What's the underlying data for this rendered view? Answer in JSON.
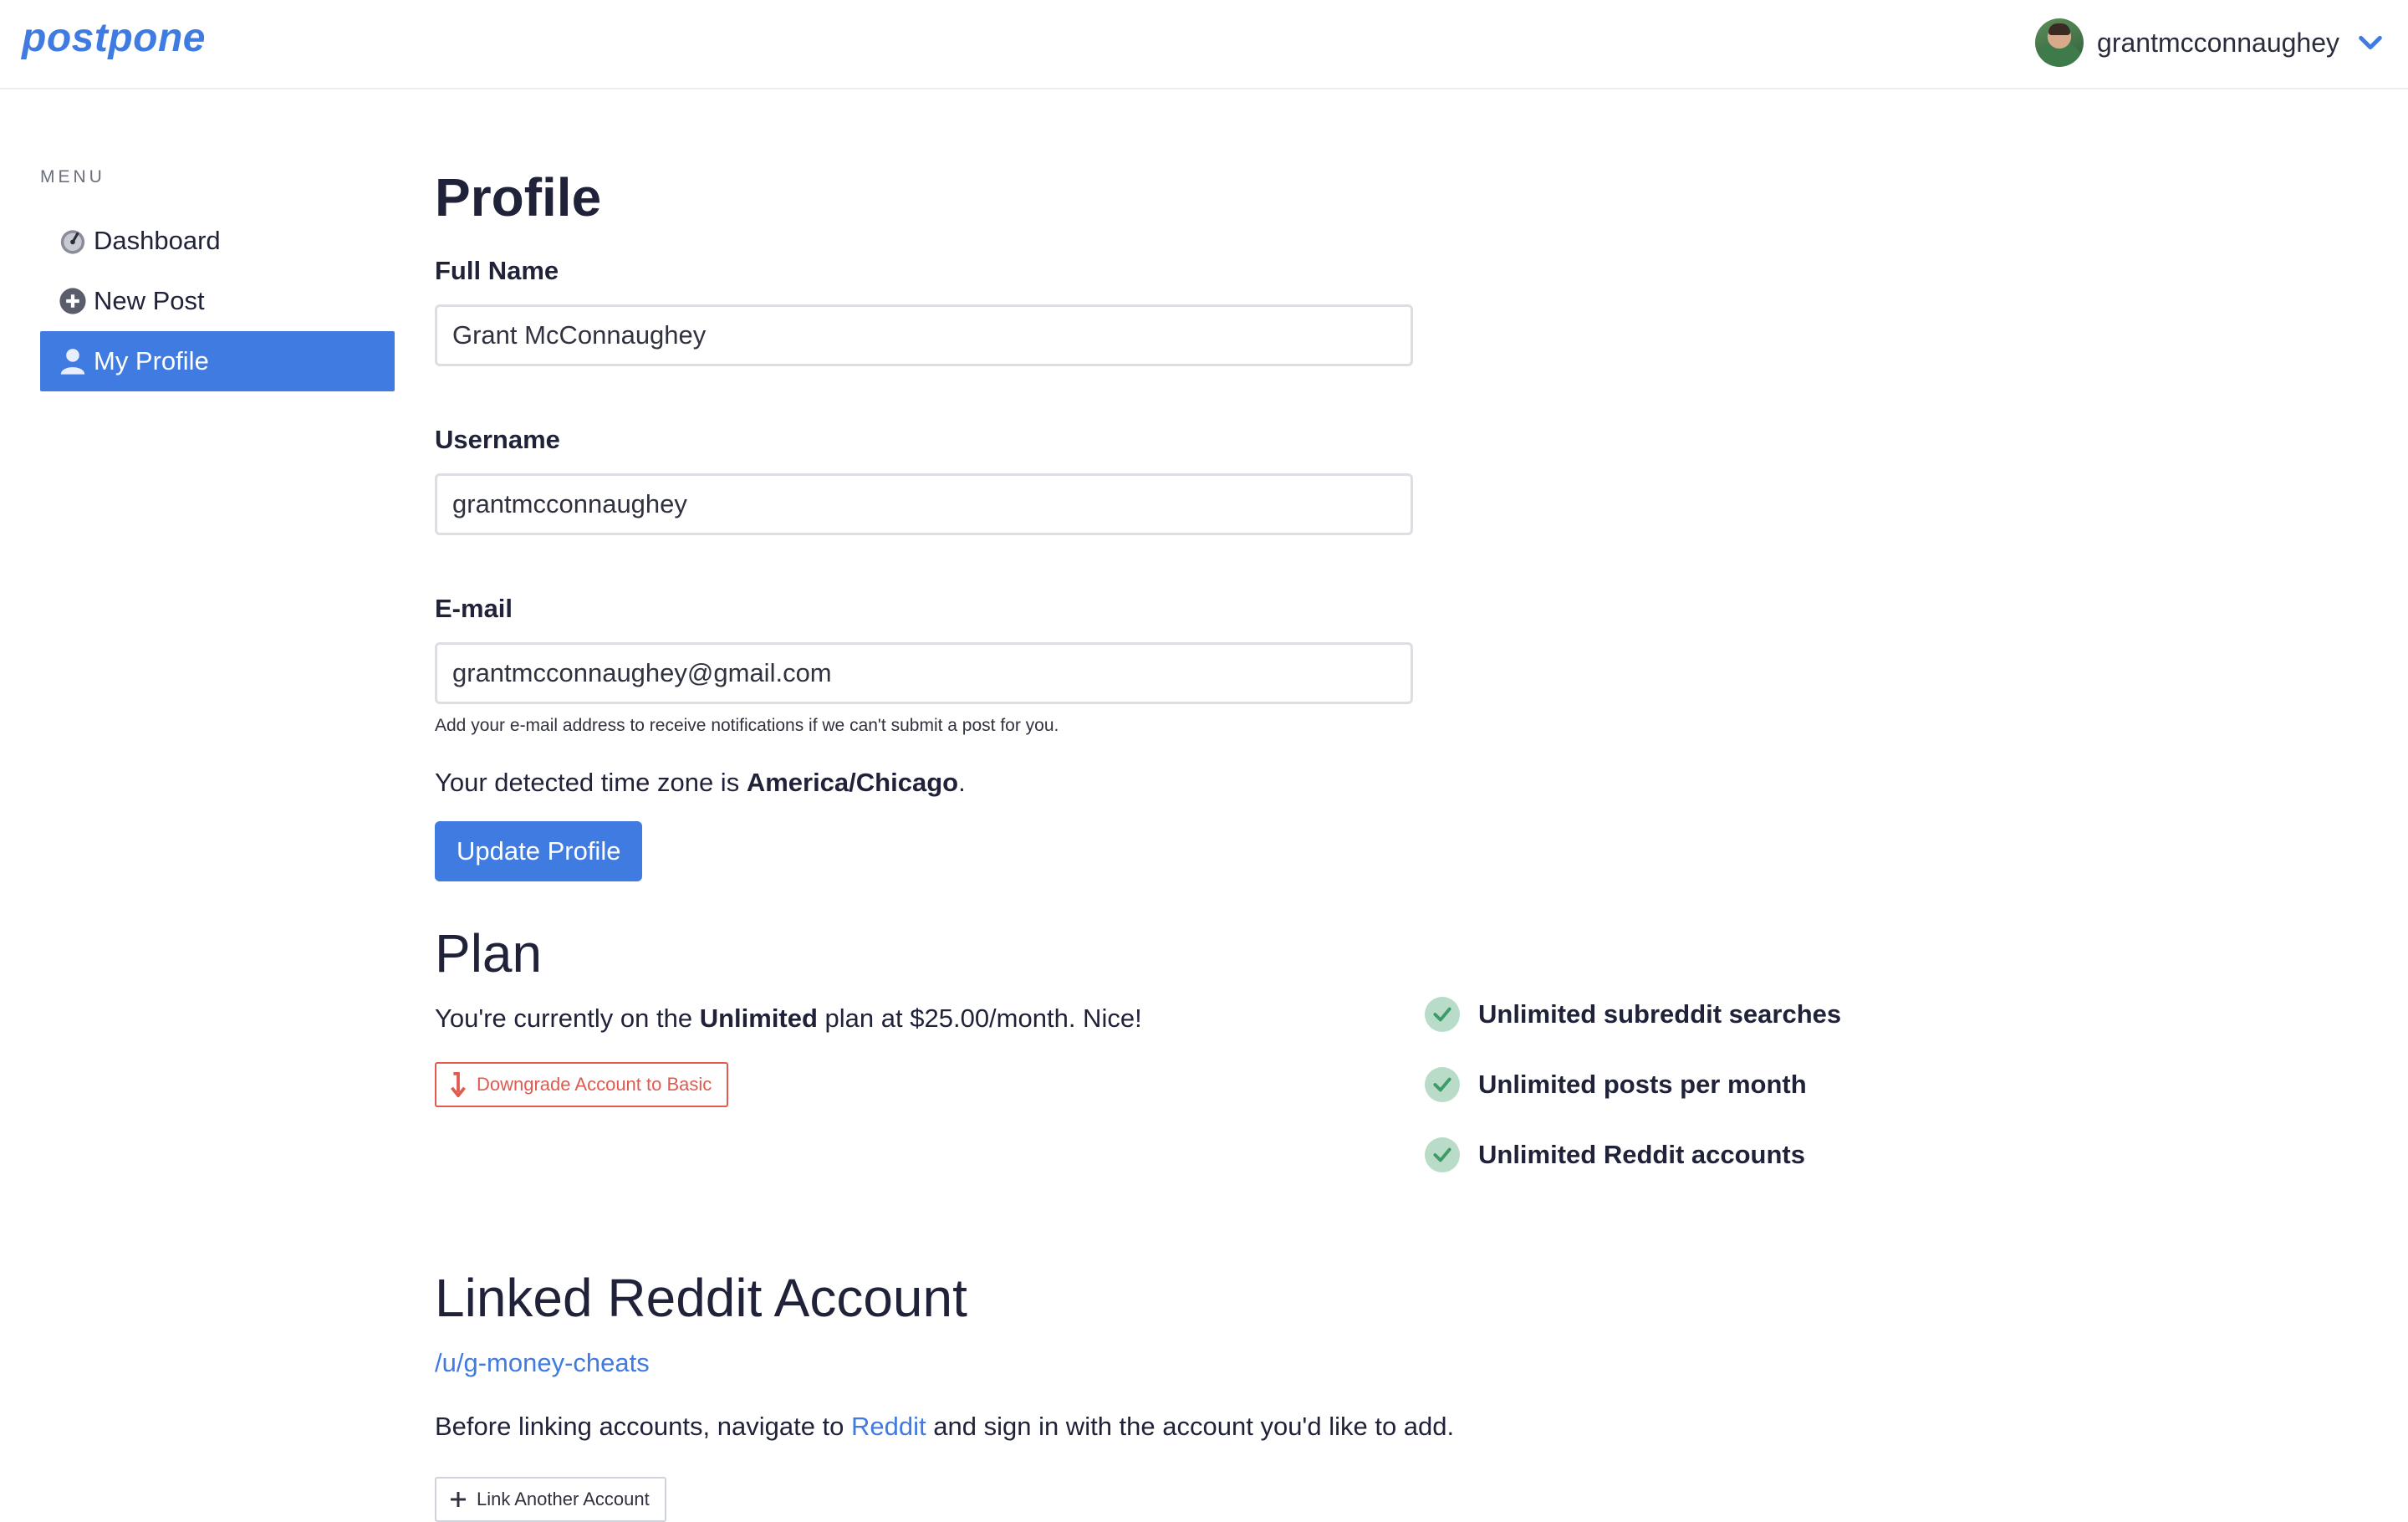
{
  "header": {
    "logo": "postpone",
    "username": "grantmcconnaughey"
  },
  "sidebar": {
    "menu_title": "MENU",
    "items": [
      {
        "label": "Dashboard",
        "icon": "dashboard-gauge-icon"
      },
      {
        "label": "New Post",
        "icon": "plus-circle-icon"
      },
      {
        "label": "My Profile",
        "icon": "user-icon",
        "active": true
      }
    ]
  },
  "profile": {
    "title": "Profile",
    "full_name_label": "Full Name",
    "full_name_value": "Grant McConnaughey",
    "username_label": "Username",
    "username_value": "grantmcconnaughey",
    "email_label": "E-mail",
    "email_value": "grantmcconnaughey@gmail.com",
    "email_help": "Add your e-mail address to receive notifications if we can't submit a post for you.",
    "tz_prefix": "Your detected time zone is ",
    "tz_value": "America/Chicago",
    "tz_suffix": ".",
    "update_button": "Update Profile"
  },
  "plan": {
    "title": "Plan",
    "text_prefix": "You're currently on the ",
    "plan_name": "Unlimited",
    "text_suffix": " plan at $25.00/month. Nice!",
    "downgrade_button": "Downgrade Account to Basic",
    "features": [
      "Unlimited subreddit searches",
      "Unlimited posts per month",
      "Unlimited Reddit accounts"
    ]
  },
  "reddit": {
    "title": "Linked Reddit Account",
    "account": "/u/g-money-cheats",
    "before_prefix": "Before linking accounts, navigate to ",
    "reddit_link": "Reddit",
    "before_suffix": " and sign in with the account you'd like to add.",
    "link_button": "Link Another Account"
  },
  "colors": {
    "accent": "#3f7be0",
    "danger": "#e05a4f",
    "check_bg": "#b8dcc8",
    "check_mark": "#3d9a69"
  }
}
